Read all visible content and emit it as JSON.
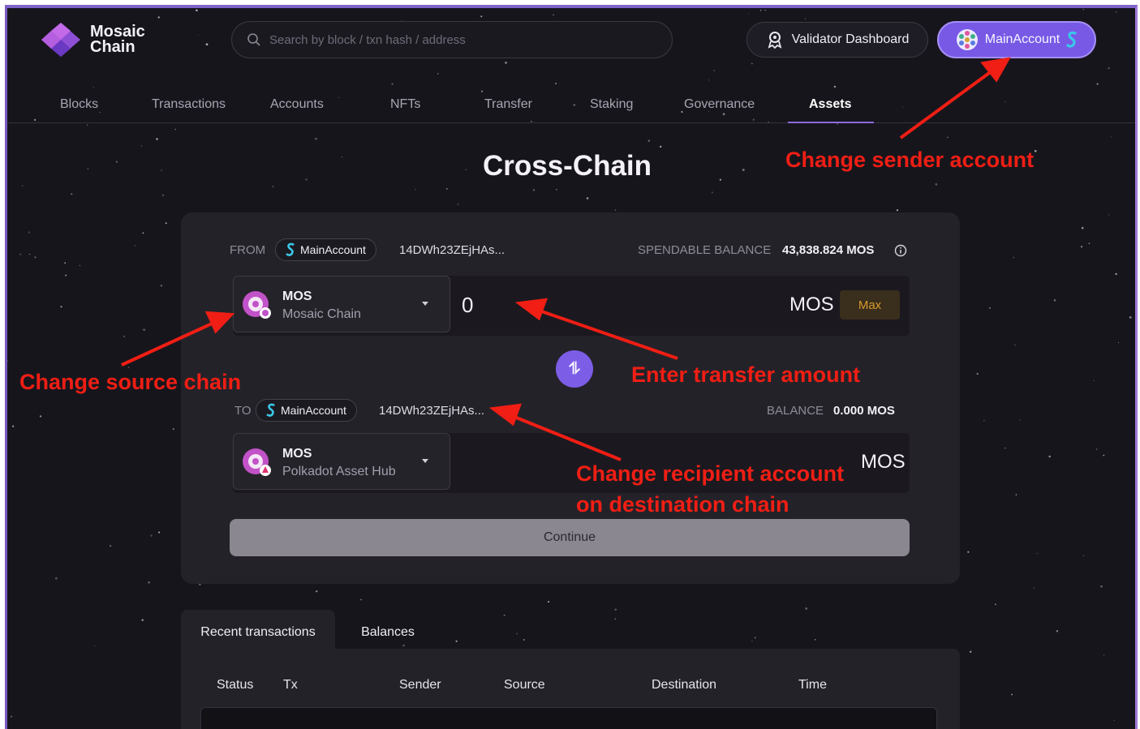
{
  "header": {
    "logo_line1": "Mosaic",
    "logo_line2": "Chain",
    "search_placeholder": "Search by block / txn hash / address",
    "validator_label": "Validator Dashboard",
    "account_label": "MainAccount"
  },
  "nav": {
    "items": [
      "Blocks",
      "Transactions",
      "Accounts",
      "NFTs",
      "Transfer",
      "Staking",
      "Governance",
      "Assets"
    ],
    "active": "Assets"
  },
  "page_title": "Cross-Chain",
  "from": {
    "label": "FROM",
    "account": "MainAccount",
    "address": "14DWh23ZEjHAs...",
    "balance_label": "SPENDABLE BALANCE",
    "balance_value": "43,838.824 MOS",
    "token_symbol": "MOS",
    "token_chain": "Mosaic Chain",
    "amount": "0",
    "unit": "MOS",
    "max_label": "Max"
  },
  "to": {
    "label": "TO",
    "account": "MainAccount",
    "address": "14DWh23ZEjHAs...",
    "balance_label": "BALANCE",
    "balance_value": "0.000 MOS",
    "token_symbol": "MOS",
    "token_chain": "Polkadot Asset Hub",
    "unit": "MOS"
  },
  "swap_icon": "⥮",
  "continue_label": "Continue",
  "tabs": [
    "Recent transactions",
    "Balances"
  ],
  "table_headers": [
    "Status",
    "Tx",
    "Sender",
    "Source",
    "Destination",
    "Time"
  ],
  "annotations": {
    "sender": "Change sender account",
    "source": "Change source chain",
    "amount": "Enter transfer amount",
    "recipient_line1": "Change recipient account",
    "recipient_line2": "on destination chain"
  },
  "colors": {
    "accent": "#7759e6",
    "annotation": "#f01e14",
    "background": "#17151c"
  }
}
